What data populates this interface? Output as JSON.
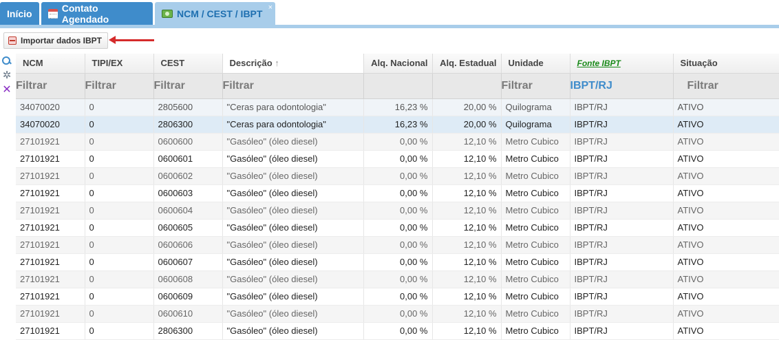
{
  "tabs": [
    {
      "label": "Início"
    },
    {
      "label": "Contato Agendado"
    },
    {
      "label": "NCM / CEST / IBPT",
      "close": "×"
    }
  ],
  "toolbar": {
    "import_label": "Importar dados IBPT"
  },
  "columns": [
    "NCM",
    "TIPI/EX",
    "CEST",
    "Descrição",
    "Alq. Nacional",
    "Alq. Estadual",
    "Unidade",
    "Fonte IBPT",
    "Situação"
  ],
  "sort_indicator": "↑",
  "filters": {
    "ncm": "Filtrar",
    "tipi": "Filtrar",
    "cest": "Filtrar",
    "descricao": "Filtrar",
    "unidade": "Filtrar",
    "fonte": "IBPT/RJ",
    "situacao": "Filtrar"
  },
  "rows": [
    [
      "34070020",
      "0",
      "2805600",
      "\"Ceras para odontologia\"",
      "16,23 %",
      "20,00 %",
      "Quilograma",
      "IBPT/RJ",
      "ATIVO"
    ],
    [
      "34070020",
      "0",
      "2806300",
      "\"Ceras para odontologia\"",
      "16,23 %",
      "20,00 %",
      "Quilograma",
      "IBPT/RJ",
      "ATIVO"
    ],
    [
      "27101921",
      "0",
      "0600600",
      "\"Gasóleo\" (óleo diesel)",
      "0,00 %",
      "12,10 %",
      "Metro Cubico",
      "IBPT/RJ",
      "ATIVO"
    ],
    [
      "27101921",
      "0",
      "0600601",
      "\"Gasóleo\" (óleo diesel)",
      "0,00 %",
      "12,10 %",
      "Metro Cubico",
      "IBPT/RJ",
      "ATIVO"
    ],
    [
      "27101921",
      "0",
      "0600602",
      "\"Gasóleo\" (óleo diesel)",
      "0,00 %",
      "12,10 %",
      "Metro Cubico",
      "IBPT/RJ",
      "ATIVO"
    ],
    [
      "27101921",
      "0",
      "0600603",
      "\"Gasóleo\" (óleo diesel)",
      "0,00 %",
      "12,10 %",
      "Metro Cubico",
      "IBPT/RJ",
      "ATIVO"
    ],
    [
      "27101921",
      "0",
      "0600604",
      "\"Gasóleo\" (óleo diesel)",
      "0,00 %",
      "12,10 %",
      "Metro Cubico",
      "IBPT/RJ",
      "ATIVO"
    ],
    [
      "27101921",
      "0",
      "0600605",
      "\"Gasóleo\" (óleo diesel)",
      "0,00 %",
      "12,10 %",
      "Metro Cubico",
      "IBPT/RJ",
      "ATIVO"
    ],
    [
      "27101921",
      "0",
      "0600606",
      "\"Gasóleo\" (óleo diesel)",
      "0,00 %",
      "12,10 %",
      "Metro Cubico",
      "IBPT/RJ",
      "ATIVO"
    ],
    [
      "27101921",
      "0",
      "0600607",
      "\"Gasóleo\" (óleo diesel)",
      "0,00 %",
      "12,10 %",
      "Metro Cubico",
      "IBPT/RJ",
      "ATIVO"
    ],
    [
      "27101921",
      "0",
      "0600608",
      "\"Gasóleo\" (óleo diesel)",
      "0,00 %",
      "12,10 %",
      "Metro Cubico",
      "IBPT/RJ",
      "ATIVO"
    ],
    [
      "27101921",
      "0",
      "0600609",
      "\"Gasóleo\" (óleo diesel)",
      "0,00 %",
      "12,10 %",
      "Metro Cubico",
      "IBPT/RJ",
      "ATIVO"
    ],
    [
      "27101921",
      "0",
      "0600610",
      "\"Gasóleo\" (óleo diesel)",
      "0,00 %",
      "12,10 %",
      "Metro Cubico",
      "IBPT/RJ",
      "ATIVO"
    ],
    [
      "27101921",
      "0",
      "2806300",
      "\"Gasóleo\" (óleo diesel)",
      "0,00 %",
      "12,10 %",
      "Metro Cubico",
      "IBPT/RJ",
      "ATIVO"
    ]
  ],
  "icons": {
    "calendar": "calendar-icon",
    "money": "money-icon",
    "import": "import-icon",
    "search": "search-icon",
    "gear": "gear-icon",
    "clear": "close-icon"
  },
  "colors": {
    "tab_blue": "#3f8ccb",
    "tab_active": "#a8cdea",
    "fonte_link": "#1a8a1a",
    "arrow": "#d52b2b"
  }
}
